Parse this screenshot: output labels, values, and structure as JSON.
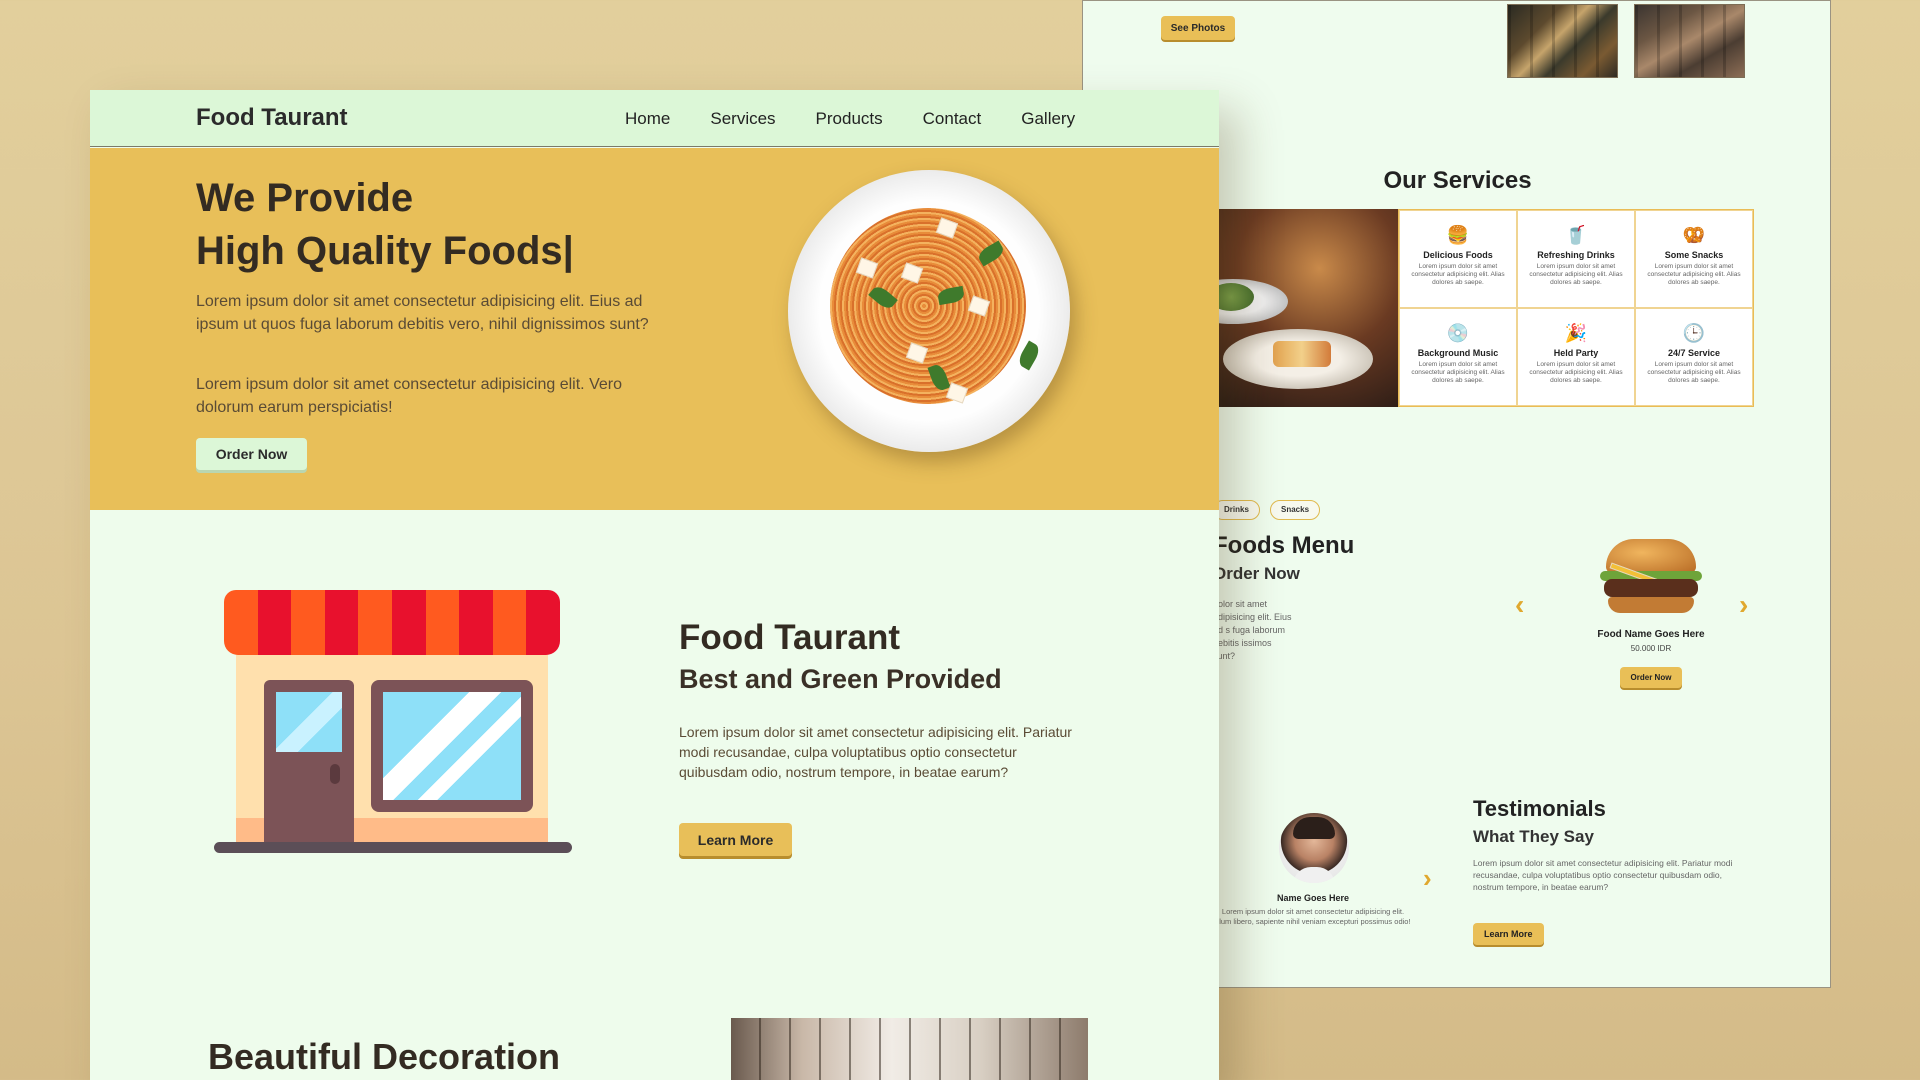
{
  "back": {
    "see_photos": "See Photos",
    "services_title": "Our Services",
    "services": [
      {
        "icon": "burger-icon",
        "glyph": "🍔",
        "name": "Delicious Foods",
        "desc": "Lorem ipsum dolor sit amet consectetur adipisicing elit. Alias dolores ab saepe."
      },
      {
        "icon": "drink-icon",
        "glyph": "🥤",
        "name": "Refreshing Drinks",
        "desc": "Lorem ipsum dolor sit amet consectetur adipisicing elit. Alias dolores ab saepe."
      },
      {
        "icon": "snack-icon",
        "glyph": "🥨",
        "name": "Some Snacks",
        "desc": "Lorem ipsum dolor sit amet consectetur adipisicing elit. Alias dolores ab saepe."
      },
      {
        "icon": "vinyl-icon",
        "glyph": "💿",
        "name": "Background Music",
        "desc": "Lorem ipsum dolor sit amet consectetur adipisicing elit. Alias dolores ab saepe."
      },
      {
        "icon": "party-icon",
        "glyph": "🎉",
        "name": "Held Party",
        "desc": "Lorem ipsum dolor sit amet consectetur adipisicing elit. Alias dolores ab saepe."
      },
      {
        "icon": "clock-24-icon",
        "glyph": "🕒",
        "name": "24/7 Service",
        "desc": "Lorem ipsum dolor sit amet consectetur adipisicing elit. Alias dolores ab saepe."
      }
    ],
    "chips": [
      "Drinks",
      "Snacks"
    ],
    "menu_title": "Foods Menu",
    "menu_sub": "Order Now",
    "menu_desc": "dolor sit amet adipisicing elit. Eius ad s fuga laborum debitis issimos sunt?",
    "food_name": "Food Name Goes Here",
    "food_price": "50.000 IDR",
    "food_order": "Order Now",
    "testimonial_name": "Name Goes Here",
    "testimonial_quote": "Lorem ipsum dolor sit amet consectetur adipisicing elit. Illum libero, sapiente nihil veniam excepturi possimus odio!",
    "testi_title": "Testimonials",
    "testi_sub": "What They Say",
    "testi_desc": "Lorem ipsum dolor sit amet consectetur adipisicing elit. Pariatur modi recusandae, culpa voluptatibus optio consectetur quibusdam odio, nostrum tempore, in beatae earum?",
    "testi_btn": "Learn More"
  },
  "front": {
    "brand": "Food Taurant",
    "nav": [
      "Home",
      "Services",
      "Products",
      "Contact",
      "Gallery"
    ],
    "hero_title_1": "We Provide",
    "hero_title_2": "High Quality Foods|",
    "hero_p1": "Lorem ipsum dolor sit amet consectetur adipisicing elit. Eius ad ipsum ut quos fuga laborum debitis vero, nihil dignissimos sunt?",
    "hero_p2": "Lorem ipsum dolor sit amet consectetur adipisicing elit. Vero dolorum earum perspiciatis!",
    "order_now": "Order Now",
    "about_title": "Food Taurant",
    "about_sub": "Best and Green Provided",
    "about_desc": "Lorem ipsum dolor sit amet consectetur adipisicing elit. Pariatur modi recusandae, culpa voluptatibus optio consectetur quibusdam odio, nostrum tempore, in beatae earum?",
    "learn_more": "Learn More",
    "deco_title": "Beautiful Decoration"
  },
  "colors": {
    "accent": "#e8bf59",
    "mint": "#dcf7d7",
    "background": "#eefcec",
    "awning_red": "#e8112d",
    "awning_orange": "#ff5a1f"
  }
}
